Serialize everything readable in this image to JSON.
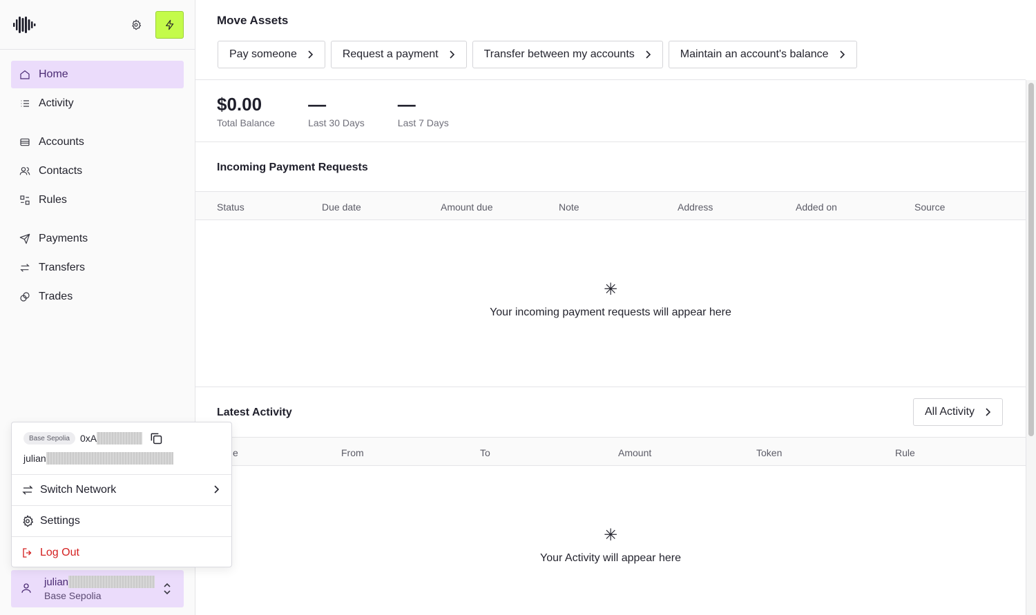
{
  "sidebar": {
    "nav": [
      {
        "label": "Home",
        "icon": "home-icon",
        "active": true
      },
      {
        "label": "Activity",
        "icon": "list-icon"
      },
      {
        "label": "Accounts",
        "icon": "wallet-icon"
      },
      {
        "label": "Contacts",
        "icon": "users-icon"
      },
      {
        "label": "Rules",
        "icon": "rules-icon"
      },
      {
        "label": "Payments",
        "icon": "send-icon"
      },
      {
        "label": "Transfers",
        "icon": "swap-icon"
      },
      {
        "label": "Trades",
        "icon": "trade-icon"
      }
    ],
    "accent_color": "#c4fb4a",
    "active_color": "#ebdcfb"
  },
  "popup": {
    "network_badge": "Base Sepolia",
    "address_prefix": "0xA",
    "username_prefix": "julian",
    "switch_network": "Switch Network",
    "settings": "Settings",
    "logout": "Log Out"
  },
  "account": {
    "name_prefix": "julian",
    "network": "Base Sepolia"
  },
  "main": {
    "move_title": "Move Assets",
    "move_buttons": [
      "Pay someone",
      "Request a payment",
      "Transfer between my accounts",
      "Maintain an account's balance"
    ],
    "stats": [
      {
        "value": "$0.00",
        "label": "Total Balance"
      },
      {
        "value": "—",
        "label": "Last 30 Days"
      },
      {
        "value": "—",
        "label": "Last 7 Days"
      }
    ],
    "incoming": {
      "title": "Incoming Payment Requests",
      "columns": [
        "Status",
        "Due date",
        "Amount due",
        "Note",
        "Address",
        "Added on",
        "Source"
      ],
      "empty": "Your incoming payment requests will appear here"
    },
    "latest": {
      "title": "Latest Activity",
      "all_button": "All Activity",
      "columns": [
        "e",
        "From",
        "To",
        "Amount",
        "Token",
        "Rule"
      ],
      "empty": "Your Activity will appear here"
    }
  }
}
